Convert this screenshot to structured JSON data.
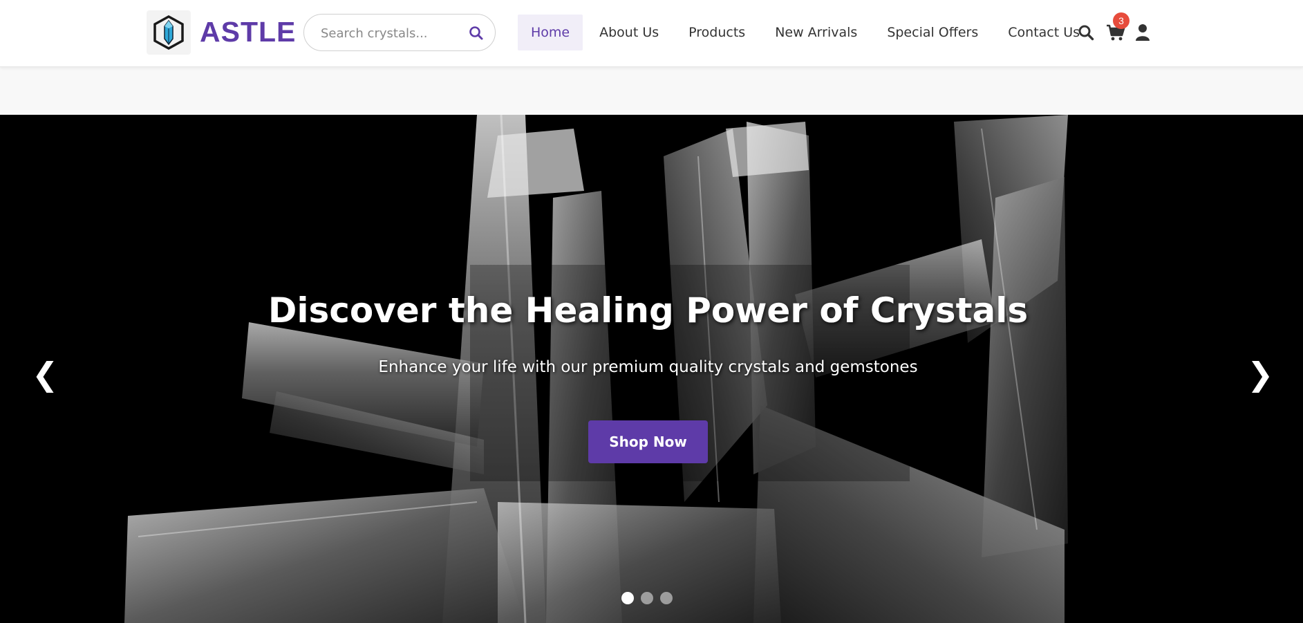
{
  "brand": {
    "name": "ASTLE",
    "logo_icon": "crystal-hexagon-logo",
    "color": "#5e3ba8"
  },
  "search": {
    "placeholder": "Search crystals...",
    "icon": "search-icon"
  },
  "nav": {
    "items": [
      {
        "label": "Home",
        "active": true
      },
      {
        "label": "About Us"
      },
      {
        "label": "Products"
      },
      {
        "label": "New Arrivals"
      },
      {
        "label": "Special Offers"
      },
      {
        "label": "Contact Us"
      }
    ]
  },
  "header_icons": {
    "search": "search-icon",
    "cart": "cart-icon",
    "user": "user-icon",
    "cart_count": "3"
  },
  "hero": {
    "title": "Discover the Healing Power of Crystals",
    "subtitle": "Enhance your life with our premium quality crystals and gemstones",
    "cta": "Shop Now",
    "prev": "❮",
    "next": "❯",
    "slide_count": 3,
    "active_slide": 1
  },
  "colors": {
    "accent": "#5e3ba8",
    "badge": "#e74c3c",
    "hero_bg": "#000000"
  }
}
